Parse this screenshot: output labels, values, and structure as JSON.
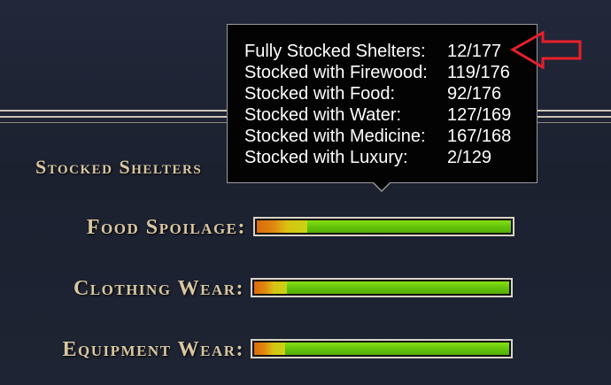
{
  "labels": {
    "stocked_shelters": "Stocked Shelters",
    "food_spoilage": "Food Spoilage:",
    "clothing_wear": "Clothing Wear:",
    "equipment_wear": "Equipment Wear:"
  },
  "bars": {
    "food_spoilage": {
      "worn_fraction": 0.2
    },
    "clothing_wear": {
      "worn_fraction": 0.13
    },
    "equipment_wear": {
      "worn_fraction": 0.12
    }
  },
  "tooltip": {
    "rows": [
      {
        "name": "Fully Stocked Shelters:",
        "value": "12/177"
      },
      {
        "name": "Stocked with Firewood:",
        "value": "119/176"
      },
      {
        "name": "Stocked with Food:",
        "value": "92/176"
      },
      {
        "name": "Stocked with Water:",
        "value": "127/169"
      },
      {
        "name": "Stocked with Medicine:",
        "value": "167/168"
      },
      {
        "name": "Stocked with Luxury:",
        "value": "2/129"
      }
    ]
  },
  "colors": {
    "label_gold": "#d9c7a1",
    "bar_good": "#6fcb0e",
    "bar_worn": "#d96a0a",
    "annotation_red": "#e8202a"
  },
  "annotation": {
    "icon": "left-arrow-outline-icon"
  }
}
